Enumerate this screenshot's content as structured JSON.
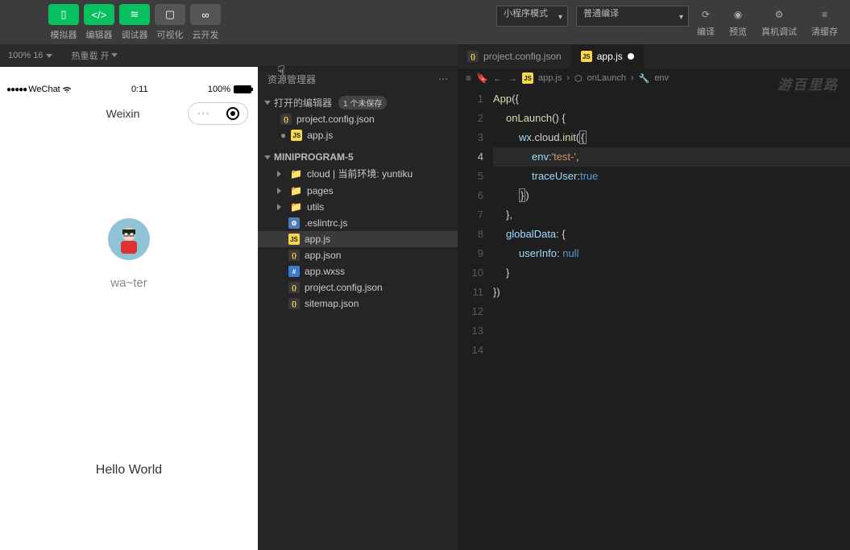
{
  "topbar": {
    "labels": {
      "sim": "模拟器",
      "editor": "编辑器",
      "debug": "调试器",
      "visual": "可视化",
      "cloud": "云开发"
    },
    "mode_select": "小程序模式",
    "compile_select": "普通编译",
    "right_labels": {
      "compile": "编译",
      "preview": "预览",
      "remote": "真机调试",
      "cache": "清缓存"
    }
  },
  "substrip": {
    "zoom": "100% 16",
    "reload": "热重载 开"
  },
  "simulator": {
    "carrier": "WeChat",
    "time": "0:11",
    "battery": "100%",
    "nav_title": "Weixin",
    "nickname": "wa~ter",
    "hello": "Hello World"
  },
  "explorer": {
    "title": "资源管理器",
    "open_editors": "打开的编辑器",
    "unsaved_badge": "1 个未保存",
    "project": "MINIPROGRAM-5",
    "files": {
      "project_config": "project.config.json",
      "appjs": "app.js",
      "cloud": "cloud | 当前环境: yuntiku",
      "pages": "pages",
      "utils": "utils",
      "eslint": ".eslintrc.js",
      "appjson": "app.json",
      "appwxss": "app.wxss",
      "sitemap": "sitemap.json"
    }
  },
  "tabs": {
    "t1": "project.config.json",
    "t2": "app.js"
  },
  "breadcrumb": {
    "file": "app.js",
    "fn": "onLaunch",
    "leaf": "env"
  },
  "code": {
    "l1a": "App",
    "l1b": "({",
    "l2a": "onLaunch",
    "l2b": "() {",
    "l3a": "wx",
    "l3b": ".cloud.",
    "l3c": "init",
    "l3d": "(",
    "l3e": "{",
    "l4a": "env",
    "l4b": ":",
    "l4c": "'test-'",
    "l4d": ",",
    "l5a": "traceUser",
    "l5b": ":",
    "l5c": "true",
    "l6a": "}",
    "l6b": ")",
    "l7": "},",
    "l8a": "globalData",
    "l8b": ": {",
    "l9a": "userInfo",
    "l9b": ": ",
    "l9c": "null",
    "l10": "}",
    "l11": "})"
  },
  "watermark": "游百里路",
  "gutter": [
    "1",
    "2",
    "3",
    "4",
    "5",
    "6",
    "7",
    "8",
    "9",
    "10",
    "11",
    "12",
    "13",
    "14"
  ]
}
